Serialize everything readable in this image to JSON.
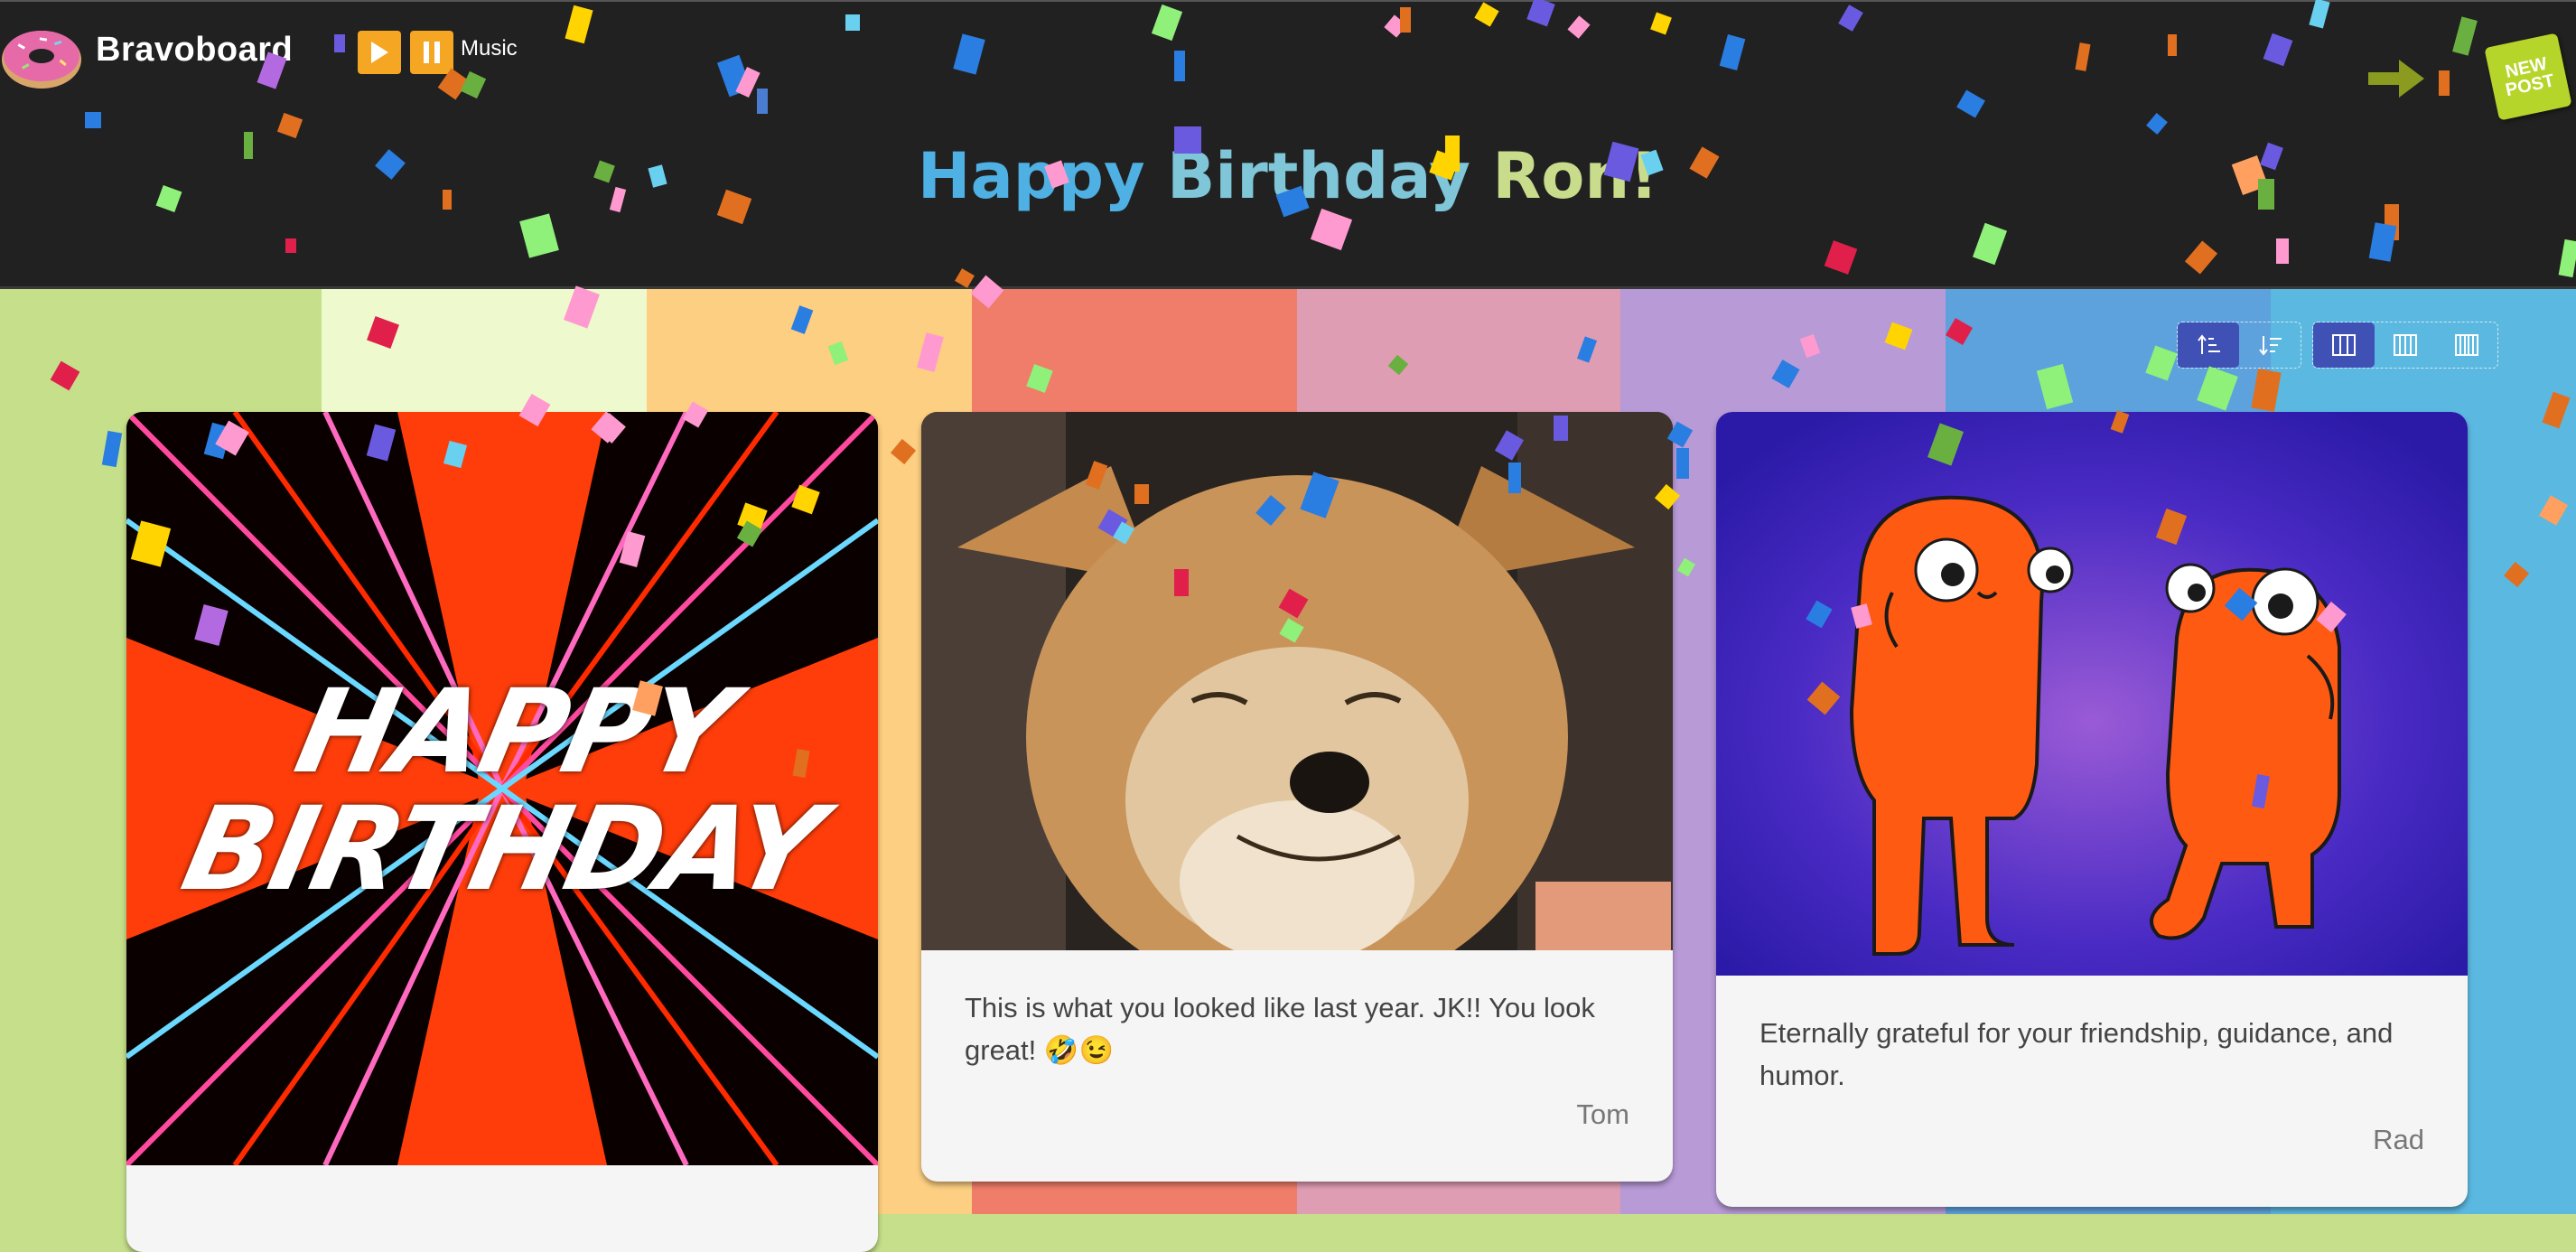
{
  "app": {
    "brand": "Bravoboard",
    "board_title": {
      "part1": "Happy",
      "part2": "Birthday",
      "part3": "Ron!"
    }
  },
  "player": {
    "play_icon": "play-icon",
    "pause_icon": "pause-icon",
    "music_label": "Music"
  },
  "header_actions": {
    "arrow_icon": "arrow-right-icon",
    "new_post_label": "NEW POST"
  },
  "toolbar": {
    "sort_icons": [
      "sort-ascending-icon",
      "sort-descending-icon"
    ],
    "layout_icons": [
      "columns-2-icon",
      "columns-3-icon",
      "columns-4-icon"
    ]
  },
  "cards": [
    {
      "image": "happy-birthday-gif",
      "image_text": "HAPPY BIRTHDAY",
      "message": "",
      "author": ""
    },
    {
      "image": "shiba-dog-gif",
      "message": "This is what you looked like last year. JK!! You look great! 🤣😉",
      "author": "Tom"
    },
    {
      "image": "orange-creatures-gif",
      "message": "Eternally grateful for your friendship, guidance, and humor.",
      "author": "Rad"
    }
  ],
  "colors": {
    "header_bg": "#212121",
    "stripes": [
      "#c5df8a",
      "#eefacd",
      "#fccf82",
      "#f07c6a",
      "#df9db4",
      "#b79ad6",
      "#5da2dc",
      "#5bb8e0"
    ],
    "active_button": "#3f51b5",
    "play_button": "#f5a623",
    "new_post": "#b6d52a"
  }
}
